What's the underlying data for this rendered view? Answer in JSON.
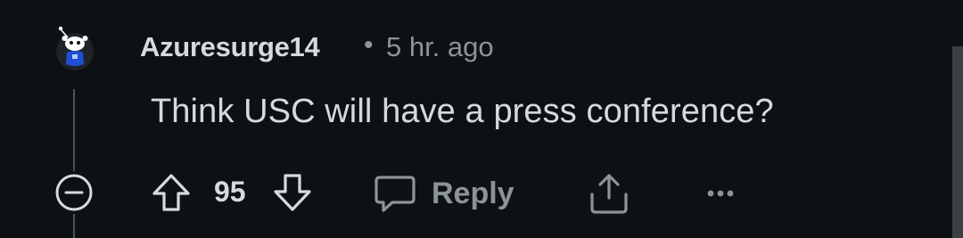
{
  "comment": {
    "author": "Azuresurge14",
    "separator": "•",
    "timestamp": "5 hr. ago",
    "body": "Think USC will have a press conference?",
    "score": "95",
    "reply_label": "Reply"
  },
  "icons": {
    "avatar": "snoo-avatar-icon",
    "collapse": "collapse-minus-icon",
    "upvote": "upvote-arrow-icon",
    "downvote": "downvote-arrow-icon",
    "reply": "speech-bubble-icon",
    "share": "share-upload-icon",
    "more": "more-dots-icon"
  },
  "colors": {
    "background": "#0e1113",
    "text_primary": "#d7dadc",
    "text_secondary": "#8b9499",
    "thread_line": "#4b5457"
  }
}
